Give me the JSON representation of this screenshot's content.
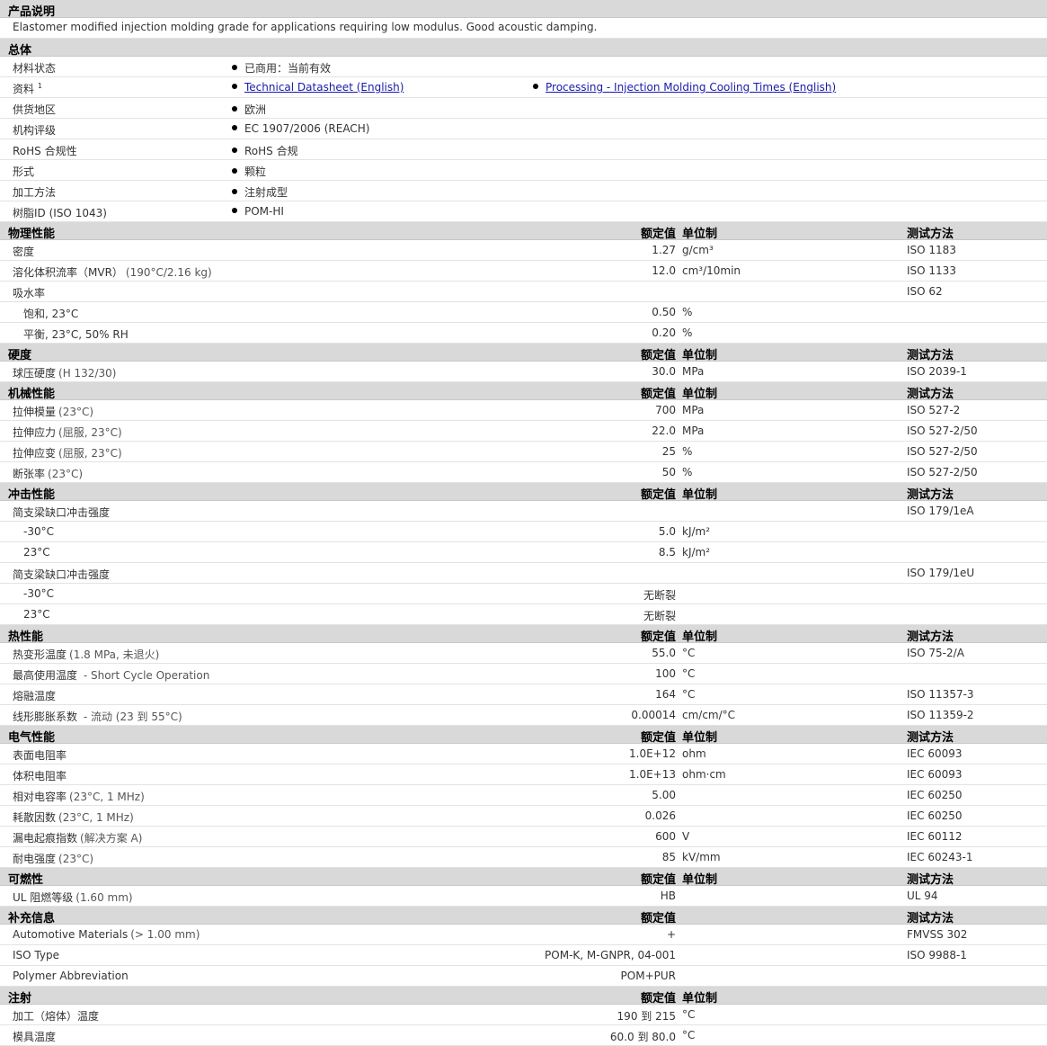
{
  "product_description": {
    "title": "产品说明",
    "text": "Elastomer modified injection molding grade for applications requiring low modulus. Good acoustic damping."
  },
  "general": {
    "title": "总体",
    "rows": [
      {
        "label": "材料状态",
        "value": "已商用：当前有效"
      },
      {
        "label": "资料",
        "sup": "1",
        "link1": "Technical Datasheet (English)",
        "link2": "Processing - Injection Molding Cooling Times (English)"
      },
      {
        "label": "供货地区",
        "value": "欧洲"
      },
      {
        "label": "机构评级",
        "value": "EC 1907/2006 (REACH)"
      },
      {
        "label": "RoHS 合规性",
        "value": "RoHS 合规"
      },
      {
        "label": "形式",
        "value": "颗粒"
      },
      {
        "label": "加工方法",
        "value": "注射成型"
      },
      {
        "label": "树脂ID (ISO 1043)",
        "value": "POM-HI"
      }
    ]
  },
  "headers": {
    "nominal": "额定值",
    "unit": "单位制",
    "test": "测试方法"
  },
  "physical": {
    "title": "物理性能",
    "rows": [
      {
        "label": "密度",
        "cond": "",
        "nominal": "1.27",
        "unit": "g/cm³",
        "test": "ISO 1183"
      },
      {
        "label": "溶化体积流率（MVR）",
        "cond": "(190°C/2.16 kg)",
        "nominal": "12.0",
        "unit": "cm³/10min",
        "test": "ISO 1133"
      },
      {
        "label": "吸水率",
        "cond": "",
        "nominal": "",
        "unit": "",
        "test": "ISO 62"
      },
      {
        "label": "饱和, 23°C",
        "cond": "",
        "nominal": "0.50",
        "unit": "%",
        "test": "",
        "sub": true
      },
      {
        "label": "平衡, 23°C, 50% RH",
        "cond": "",
        "nominal": "0.20",
        "unit": "%",
        "test": "",
        "sub": true
      }
    ]
  },
  "hardness": {
    "title": "硬度",
    "rows": [
      {
        "label": "球压硬度",
        "cond": "(H 132/30)",
        "nominal": "30.0",
        "unit": "MPa",
        "test": "ISO 2039-1"
      }
    ]
  },
  "mechanical": {
    "title": "机械性能",
    "rows": [
      {
        "label": "拉伸模量",
        "cond": "(23°C)",
        "nominal": "700",
        "unit": "MPa",
        "test": "ISO 527-2"
      },
      {
        "label": "拉伸应力",
        "cond": "(屈服, 23°C)",
        "nominal": "22.0",
        "unit": "MPa",
        "test": "ISO 527-2/50"
      },
      {
        "label": "拉伸应变",
        "cond": "(屈服, 23°C)",
        "nominal": "25",
        "unit": "%",
        "test": "ISO 527-2/50"
      },
      {
        "label": "断张率",
        "cond": "(23°C)",
        "nominal": "50",
        "unit": "%",
        "test": "ISO 527-2/50"
      }
    ]
  },
  "impact": {
    "title": "冲击性能",
    "rows": [
      {
        "label": "简支梁缺口冲击强度",
        "cond": "",
        "nominal": "",
        "unit": "",
        "test": "ISO 179/1eA"
      },
      {
        "label": "-30°C",
        "cond": "",
        "nominal": "5.0",
        "unit": "kJ/m²",
        "test": "",
        "sub": true
      },
      {
        "label": "23°C",
        "cond": "",
        "nominal": "8.5",
        "unit": "kJ/m²",
        "test": "",
        "sub": true
      },
      {
        "label": "简支梁缺口冲击强度",
        "cond": "",
        "nominal": "",
        "unit": "",
        "test": "ISO 179/1eU"
      },
      {
        "label": "-30°C",
        "cond": "",
        "nominal": "无断裂",
        "unit": "",
        "test": "",
        "sub": true
      },
      {
        "label": "23°C",
        "cond": "",
        "nominal": "无断裂",
        "unit": "",
        "test": "",
        "sub": true
      }
    ]
  },
  "thermal": {
    "title": "热性能",
    "rows": [
      {
        "label": "热变形温度",
        "cond": "(1.8 MPa, 未退火)",
        "nominal": "55.0",
        "unit": "°C",
        "test": "ISO 75-2/A"
      },
      {
        "label": "最高使用温度",
        "cond": " - Short Cycle Operation",
        "nominal": "100",
        "unit": "°C",
        "test": ""
      },
      {
        "label": "熔融温度",
        "cond": "",
        "nominal": "164",
        "unit": "°C",
        "test": "ISO 11357-3"
      },
      {
        "label": "线形膨胀系数",
        "cond": " - 流动 (23 到 55°C)",
        "nominal": "0.00014",
        "unit": "cm/cm/°C",
        "test": "ISO 11359-2"
      }
    ]
  },
  "electrical": {
    "title": "电气性能",
    "rows": [
      {
        "label": "表面电阻率",
        "cond": "",
        "nominal": "1.0E+12",
        "unit": "ohm",
        "test": "IEC 60093"
      },
      {
        "label": "体积电阻率",
        "cond": "",
        "nominal": "1.0E+13",
        "unit": "ohm·cm",
        "test": "IEC 60093"
      },
      {
        "label": "相对电容率",
        "cond": "(23°C, 1 MHz)",
        "nominal": "5.00",
        "unit": "",
        "test": "IEC 60250"
      },
      {
        "label": "耗散因数",
        "cond": "(23°C, 1 MHz)",
        "nominal": "0.026",
        "unit": "",
        "test": "IEC 60250"
      },
      {
        "label": "漏电起痕指数",
        "cond": "(解决方案 A)",
        "nominal": "600",
        "unit": "V",
        "test": "IEC 60112"
      },
      {
        "label": "耐电强度",
        "cond": "(23°C)",
        "nominal": "85",
        "unit": "kV/mm",
        "test": "IEC 60243-1"
      }
    ]
  },
  "flammability": {
    "title": "可燃性",
    "rows": [
      {
        "label": "UL 阻燃等级",
        "cond": "(1.60 mm)",
        "nominal": "HB",
        "unit": "",
        "test": "UL 94"
      }
    ]
  },
  "supplemental": {
    "title": "补充信息",
    "rows": [
      {
        "label": "Automotive Materials",
        "cond": "(> 1.00 mm)",
        "nominal": "+",
        "unit": "",
        "test": "FMVSS 302"
      },
      {
        "label": "ISO Type",
        "cond": "",
        "nominal": "POM-K, M-GNPR, 04-001",
        "unit": "",
        "test": "ISO 9988-1"
      },
      {
        "label": "Polymer Abbreviation",
        "cond": "",
        "nominal": "POM+PUR",
        "unit": "",
        "test": ""
      }
    ]
  },
  "injection": {
    "title": "注射",
    "rows": [
      {
        "label": "加工（熔体）温度",
        "cond": "",
        "nominal": "190 到  215",
        "unit": "°C",
        "test": ""
      },
      {
        "label": "模具温度",
        "cond": "",
        "nominal": "60.0 到  80.0",
        "unit": "°C",
        "test": ""
      }
    ]
  }
}
